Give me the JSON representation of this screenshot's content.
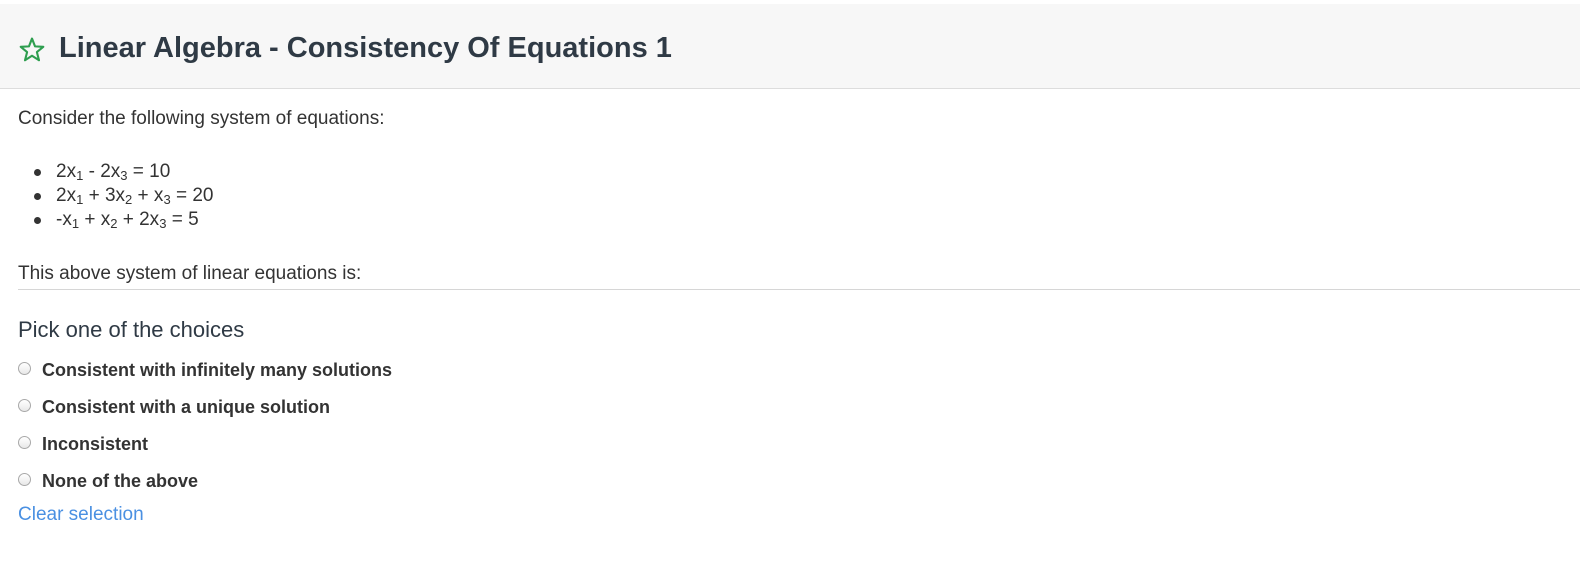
{
  "header": {
    "title": "Linear Algebra - Consistency Of Equations 1",
    "star_icon": "star-outline-icon",
    "star_color": "#2e9e4f"
  },
  "question": {
    "prompt": "Consider the following system of equations:",
    "equations": [
      [
        {
          "t": "2x"
        },
        {
          "sub": "1"
        },
        {
          "t": " - 2x"
        },
        {
          "sub": "3"
        },
        {
          "t": " = 10"
        }
      ],
      [
        {
          "t": "2x"
        },
        {
          "sub": "1"
        },
        {
          "t": " + 3x"
        },
        {
          "sub": "2"
        },
        {
          "t": " + x"
        },
        {
          "sub": "3"
        },
        {
          "t": " = 20"
        }
      ],
      [
        {
          "t": "-x"
        },
        {
          "sub": "1"
        },
        {
          "t": " + x"
        },
        {
          "sub": "2"
        },
        {
          "t": " + 2x"
        },
        {
          "sub": "3"
        },
        {
          "t": " = 5"
        }
      ]
    ],
    "summary": "This above system of linear equations is:"
  },
  "choices": {
    "heading": "Pick one of the choices",
    "options": [
      {
        "label": "Consistent with infinitely many solutions"
      },
      {
        "label": "Consistent with a unique solution"
      },
      {
        "label": "Inconsistent"
      },
      {
        "label": "None of the above"
      }
    ],
    "clear_label": "Clear selection",
    "link_color": "#4a90e2"
  }
}
